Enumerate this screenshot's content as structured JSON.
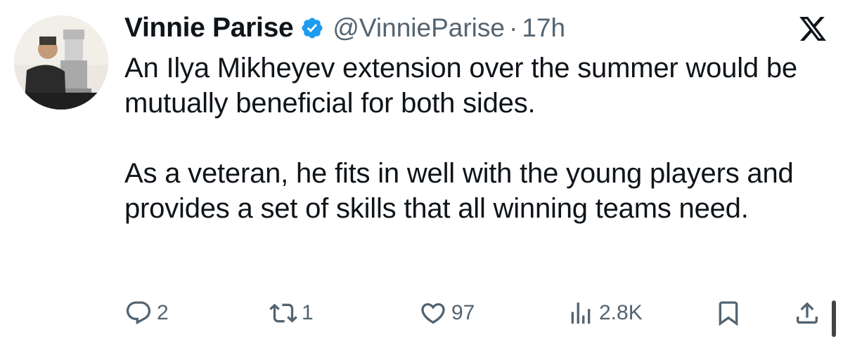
{
  "tweet": {
    "author": {
      "display_name": "Vinnie Parise",
      "handle": "@VinnieParise",
      "verified_icon": "verified-badge-icon",
      "avatar": "avatar-photo"
    },
    "separator": "·",
    "time": "17h",
    "platform_logo": "x-logo-icon",
    "text": {
      "paragraph_1": "An Ilya Mikheyev extension over the summer would be mutually beneficial for both sides.",
      "paragraph_2": "As a veteran, he fits in well with the young players and provides a set of skills that all winning teams need."
    },
    "actions": {
      "replies": "2",
      "reposts": "1",
      "likes": "97",
      "views": "2.8K"
    }
  },
  "colors": {
    "text_primary": "#0f1419",
    "text_secondary": "#536471",
    "verified_blue": "#1d9bf0"
  }
}
